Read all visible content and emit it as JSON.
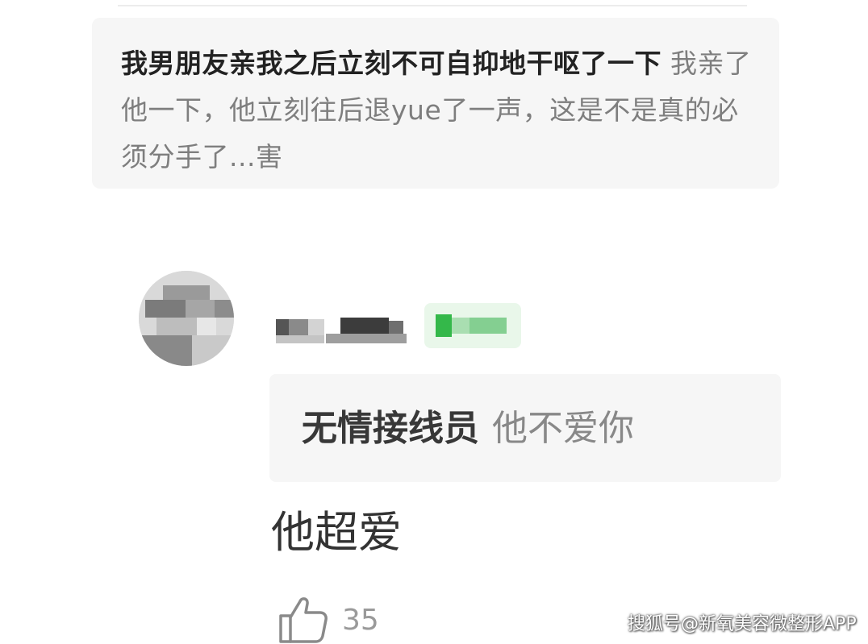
{
  "post": {
    "title": "我男朋友亲我之后立刻不可自抑地干呕了一下",
    "body": "我亲了他一下，他立刻往后退yue了一声，这是不是真的必须分手了...害"
  },
  "comment": {
    "quoted_reply": {
      "author": "无情接线员",
      "text": "他不爱你"
    },
    "reply_text": "他超爱",
    "like_count": "35"
  },
  "watermark": "搜狐号@新氧美容微整形APP",
  "icons": {
    "like": "thumbs-up-icon"
  }
}
